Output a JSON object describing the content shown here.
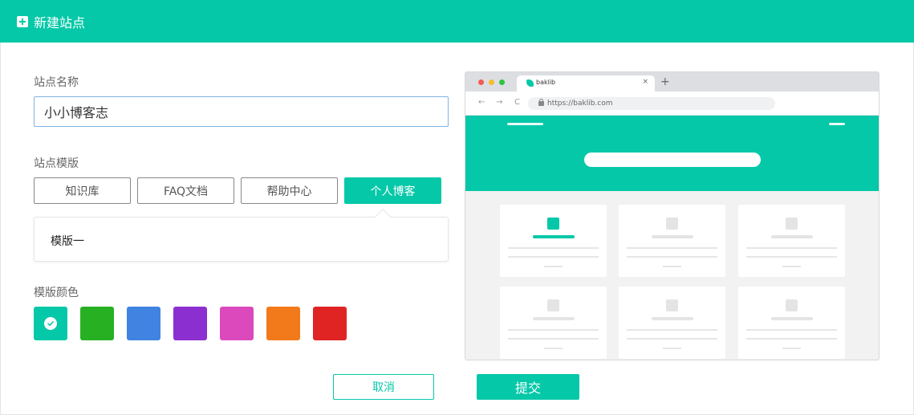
{
  "header": {
    "title": "新建站点"
  },
  "form": {
    "name_label": "站点名称",
    "name_value": "小小博客志",
    "template_label": "站点模版",
    "templates": [
      "知识库",
      "FAQ文档",
      "帮助中心",
      "个人博客"
    ],
    "selected_template": "个人博客",
    "variant_item": "模版一",
    "color_label": "模版颜色",
    "colors": [
      "#05c8a8",
      "#27b022",
      "#4183e0",
      "#8c2fd0",
      "#db49bd",
      "#f27a1a",
      "#e02424"
    ],
    "selected_color": "#05c8a8"
  },
  "preview": {
    "tab_title": "baklib",
    "tab_close": "×",
    "new_tab": "+",
    "url": "https://baklib.com",
    "nav_back": "←",
    "nav_forward": "→",
    "nav_reload": "C"
  },
  "actions": {
    "cancel": "取消",
    "submit": "提交"
  }
}
